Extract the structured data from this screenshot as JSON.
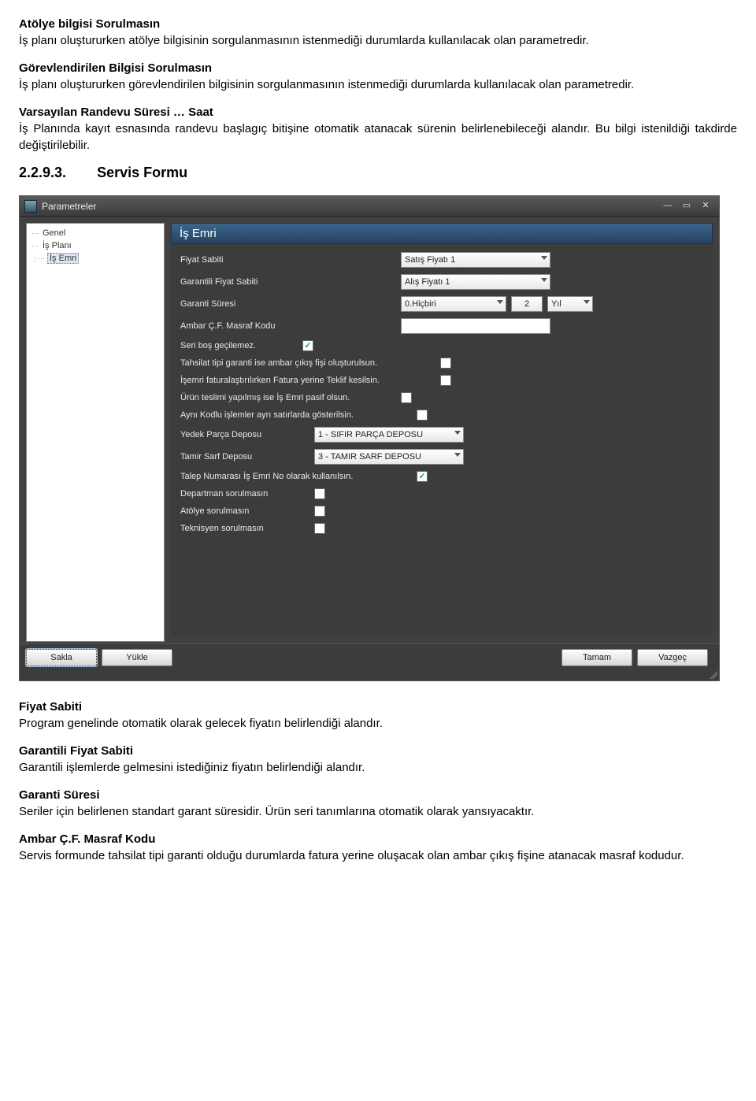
{
  "sections": {
    "atolye": {
      "title": "Atölye bilgisi Sorulmasın",
      "text": "İş planı oluştururken atölye bilgisinin sorgulanmasının istenmediği durumlarda kullanılacak olan parametredir."
    },
    "gorevlendirilen": {
      "title": "Görevlendirilen Bilgisi Sorulmasın",
      "text": "İş planı oluştururken görevlendirilen bilgisinin sorgulanmasının istenmediği durumlarda kullanılacak olan parametredir."
    },
    "randevu": {
      "title": "Varsayılan Randevu Süresi … Saat",
      "text": "İş Planında kayıt esnasında randevu başlagıç bitişine otomatik atanacak sürenin belirlenebileceği alandır. Bu bilgi istenildiği takdirde değiştirilebilir."
    },
    "servis": {
      "num": "2.2.9.3.",
      "title": "Servis Formu"
    },
    "fiyat_sabiti": {
      "title": "Fiyat Sabiti",
      "text": "Program genelinde otomatik olarak gelecek fiyatın belirlendiği alandır."
    },
    "garantili_fiyat": {
      "title": "Garantili Fiyat Sabiti",
      "text": "Garantili işlemlerde gelmesini istediğiniz fiyatın belirlendiği alandır."
    },
    "garanti_suresi": {
      "title": "Garanti Süresi",
      "text": "Seriler için belirlenen standart garant süresidir. Ürün seri tanımlarına otomatik olarak yansıyacaktır."
    },
    "masraf_kodu": {
      "title": "Ambar Ç.F. Masraf Kodu",
      "text": "Servis formunde tahsilat tipi garanti olduğu durumlarda fatura yerine oluşacak olan ambar çıkış fişine atanacak masraf kodudur."
    }
  },
  "win": {
    "title": "Parametreler",
    "tree": {
      "0": "Genel",
      "1": "İş Planı",
      "2": "İş Emri"
    },
    "panel_title": "İş Emri",
    "fields": {
      "fiyat_sabiti": {
        "label": "Fiyat Sabiti",
        "value": "Satış Fiyatı 1"
      },
      "garantili_fiyat": {
        "label": "Garantili Fiyat Sabiti",
        "value": "Alış Fiyatı 1"
      },
      "garanti": {
        "label": "Garanti Süresi",
        "value": "0.Hiçbiri",
        "num": "2",
        "unit": "Yıl"
      },
      "masraf": {
        "label": "Ambar Ç.F. Masraf Kodu",
        "value": ""
      },
      "seri": {
        "label": "Seri boş geçilemez."
      },
      "tahsilat": {
        "label": "Tahsilat tipi garanti ise ambar çıkış fişi oluşturulsun."
      },
      "fatura": {
        "label": "İşemri faturalaştırılırken Fatura yerine Teklif kesilsin."
      },
      "teslim": {
        "label": "Ürün teslimi yapılmış ise İş Emri pasif olsun."
      },
      "ayni": {
        "label": "Aynı Kodlu işlemler ayrı satırlarda gösterilsin."
      },
      "yedek": {
        "label": "Yedek Parça Deposu",
        "value": "1 - SIFIR PARÇA DEPOSU"
      },
      "tamir": {
        "label": "Tamir Sarf Deposu",
        "value": "3 - TAMIR SARF DEPOSU"
      },
      "talep": {
        "label": "Talep Numarası İş Emri No olarak kullanılsın."
      },
      "departman": {
        "label": "Departman sorulmasın"
      },
      "atolye": {
        "label": "Atölye sorulmasın"
      },
      "teknisyen": {
        "label": "Teknisyen sorulmasın"
      }
    },
    "buttons": {
      "sakla": "Sakla",
      "yukle": "Yükle",
      "tamam": "Tamam",
      "vazgec": "Vazgeç"
    }
  }
}
